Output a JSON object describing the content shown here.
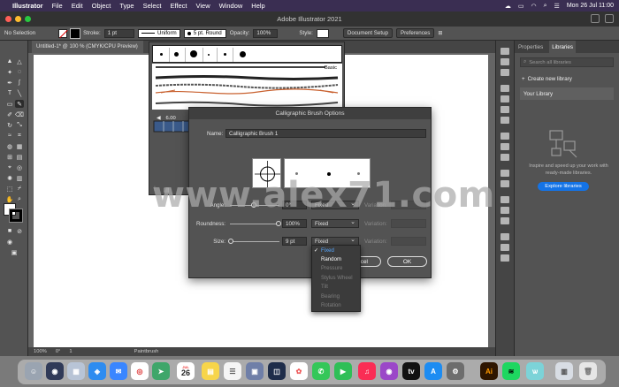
{
  "menubar": {
    "app": "Illustrator",
    "items": [
      "File",
      "Edit",
      "Object",
      "Type",
      "Select",
      "Effect",
      "View",
      "Window",
      "Help"
    ],
    "clock": "Mon 26 Jul  11:00"
  },
  "titlebar": {
    "title": "Adobe Illustrator 2021"
  },
  "controlbar": {
    "selection": "No Selection",
    "stroke_label": "Stroke:",
    "stroke_value": "1 pt",
    "profile": "Uniform",
    "brush": "5 pt. Round",
    "opacity_label": "Opacity:",
    "opacity_value": "100%",
    "style_label": "Style:",
    "doc_setup": "Document Setup",
    "preferences": "Preferences"
  },
  "document": {
    "tab": "Untitled-1* @ 100 % (CMYK/CPU Preview)"
  },
  "statusbar": {
    "zoom": "100%",
    "rotation": "0°",
    "page": "1",
    "tool": "Paintbrush"
  },
  "brushes_panel": {
    "basic_label": "Basic",
    "size_value": "6.00"
  },
  "dialog": {
    "title": "Calligraphic Brush Options",
    "name_label": "Name:",
    "name_value": "Calligraphic Brush 1",
    "angle": {
      "label": "Angle:",
      "value": "0°",
      "mode": "Fixed",
      "var_label": "Variation:"
    },
    "roundness": {
      "label": "Roundness:",
      "value": "100%",
      "mode": "Fixed",
      "var_label": "Variation:"
    },
    "size": {
      "label": "Size:",
      "value": "9 pt",
      "mode": "Fixed",
      "var_label": "Variation:"
    },
    "cancel": "Cancel",
    "ok": "OK"
  },
  "dropdown": {
    "options": [
      "Fixed",
      "Random",
      "Pressure",
      "Stylus Wheel",
      "Tilt",
      "Bearing",
      "Rotation"
    ],
    "selected": "Fixed"
  },
  "right_panel": {
    "tab_properties": "Properties",
    "tab_libraries": "Libraries",
    "search_placeholder": "Search all libraries",
    "create_library": "Create new library",
    "your_library": "Your Library",
    "description": "Inspire and speed up your work with ready-made libraries.",
    "explore": "Explore libraries"
  },
  "dock": {
    "calendar_day": "26",
    "calendar_month": "JUL"
  },
  "watermark": "www.alex71.com",
  "colors": {
    "accent": "#1473e6",
    "menubar": "#3a2e52",
    "panel": "#535353"
  }
}
